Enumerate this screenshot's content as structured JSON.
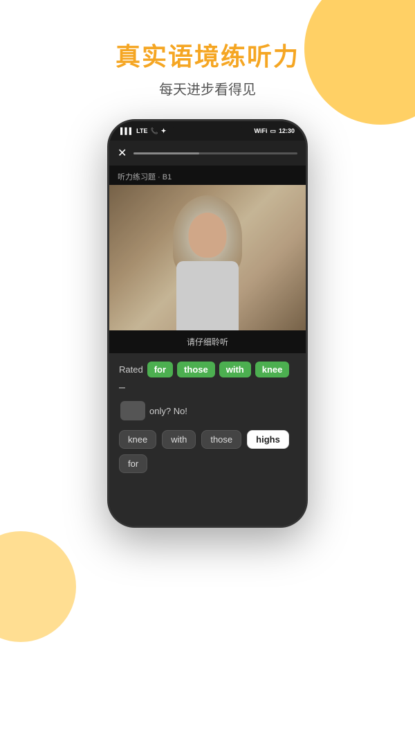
{
  "header": {
    "main_title": "真实语境练听力",
    "sub_title": "每天进步看得见"
  },
  "status_bar": {
    "signal": "▌▌▌",
    "network": "LTE",
    "phone_icon": "☎",
    "bluetooth": "✦",
    "wifi": "▲",
    "battery": "▭",
    "time": "12:30"
  },
  "screen": {
    "exercise_label": "听力练习题 · B1",
    "listen_instruction": "请仔细聆听",
    "close_button": "✕",
    "sentence_label": "Rated",
    "sentence_words": [
      {
        "text": "for",
        "type": "green"
      },
      {
        "text": "those",
        "type": "green"
      },
      {
        "text": "with",
        "type": "green"
      },
      {
        "text": "knee",
        "type": "green"
      }
    ],
    "dash": "–",
    "blank_then_text": "only?  No!",
    "options": [
      {
        "text": "knee",
        "type": "default"
      },
      {
        "text": "with",
        "type": "default"
      },
      {
        "text": "those",
        "type": "default"
      },
      {
        "text": "highs",
        "type": "selected"
      },
      {
        "text": "for",
        "type": "default"
      }
    ]
  },
  "colors": {
    "orange": "#F5A623",
    "green": "#4CAF50",
    "dark_panel": "#2a2a2a",
    "white": "#ffffff"
  }
}
